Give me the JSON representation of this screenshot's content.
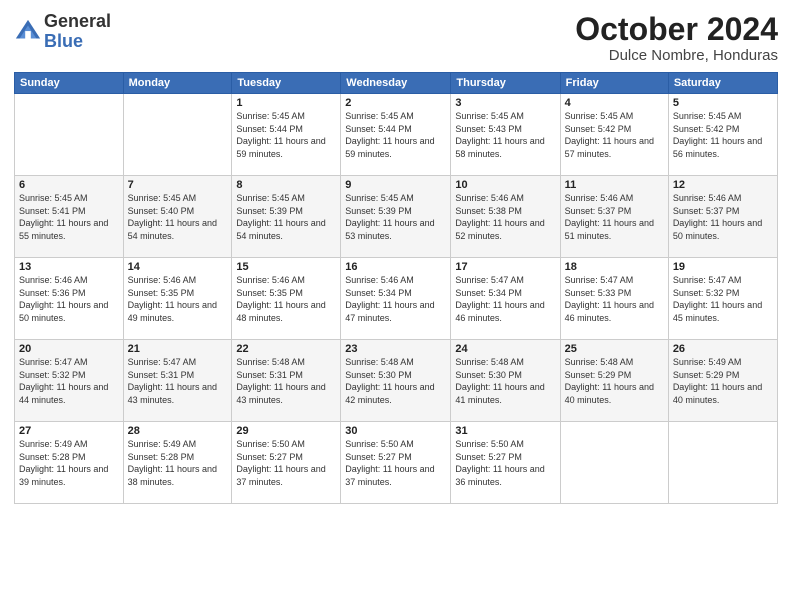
{
  "logo": {
    "general": "General",
    "blue": "Blue"
  },
  "header": {
    "month": "October 2024",
    "location": "Dulce Nombre, Honduras"
  },
  "weekdays": [
    "Sunday",
    "Monday",
    "Tuesday",
    "Wednesday",
    "Thursday",
    "Friday",
    "Saturday"
  ],
  "weeks": [
    [
      {
        "day": "",
        "sunrise": "",
        "sunset": "",
        "daylight": ""
      },
      {
        "day": "",
        "sunrise": "",
        "sunset": "",
        "daylight": ""
      },
      {
        "day": "1",
        "sunrise": "Sunrise: 5:45 AM",
        "sunset": "Sunset: 5:44 PM",
        "daylight": "Daylight: 11 hours and 59 minutes."
      },
      {
        "day": "2",
        "sunrise": "Sunrise: 5:45 AM",
        "sunset": "Sunset: 5:44 PM",
        "daylight": "Daylight: 11 hours and 59 minutes."
      },
      {
        "day": "3",
        "sunrise": "Sunrise: 5:45 AM",
        "sunset": "Sunset: 5:43 PM",
        "daylight": "Daylight: 11 hours and 58 minutes."
      },
      {
        "day": "4",
        "sunrise": "Sunrise: 5:45 AM",
        "sunset": "Sunset: 5:42 PM",
        "daylight": "Daylight: 11 hours and 57 minutes."
      },
      {
        "day": "5",
        "sunrise": "Sunrise: 5:45 AM",
        "sunset": "Sunset: 5:42 PM",
        "daylight": "Daylight: 11 hours and 56 minutes."
      }
    ],
    [
      {
        "day": "6",
        "sunrise": "Sunrise: 5:45 AM",
        "sunset": "Sunset: 5:41 PM",
        "daylight": "Daylight: 11 hours and 55 minutes."
      },
      {
        "day": "7",
        "sunrise": "Sunrise: 5:45 AM",
        "sunset": "Sunset: 5:40 PM",
        "daylight": "Daylight: 11 hours and 54 minutes."
      },
      {
        "day": "8",
        "sunrise": "Sunrise: 5:45 AM",
        "sunset": "Sunset: 5:39 PM",
        "daylight": "Daylight: 11 hours and 54 minutes."
      },
      {
        "day": "9",
        "sunrise": "Sunrise: 5:45 AM",
        "sunset": "Sunset: 5:39 PM",
        "daylight": "Daylight: 11 hours and 53 minutes."
      },
      {
        "day": "10",
        "sunrise": "Sunrise: 5:46 AM",
        "sunset": "Sunset: 5:38 PM",
        "daylight": "Daylight: 11 hours and 52 minutes."
      },
      {
        "day": "11",
        "sunrise": "Sunrise: 5:46 AM",
        "sunset": "Sunset: 5:37 PM",
        "daylight": "Daylight: 11 hours and 51 minutes."
      },
      {
        "day": "12",
        "sunrise": "Sunrise: 5:46 AM",
        "sunset": "Sunset: 5:37 PM",
        "daylight": "Daylight: 11 hours and 50 minutes."
      }
    ],
    [
      {
        "day": "13",
        "sunrise": "Sunrise: 5:46 AM",
        "sunset": "Sunset: 5:36 PM",
        "daylight": "Daylight: 11 hours and 50 minutes."
      },
      {
        "day": "14",
        "sunrise": "Sunrise: 5:46 AM",
        "sunset": "Sunset: 5:35 PM",
        "daylight": "Daylight: 11 hours and 49 minutes."
      },
      {
        "day": "15",
        "sunrise": "Sunrise: 5:46 AM",
        "sunset": "Sunset: 5:35 PM",
        "daylight": "Daylight: 11 hours and 48 minutes."
      },
      {
        "day": "16",
        "sunrise": "Sunrise: 5:46 AM",
        "sunset": "Sunset: 5:34 PM",
        "daylight": "Daylight: 11 hours and 47 minutes."
      },
      {
        "day": "17",
        "sunrise": "Sunrise: 5:47 AM",
        "sunset": "Sunset: 5:34 PM",
        "daylight": "Daylight: 11 hours and 46 minutes."
      },
      {
        "day": "18",
        "sunrise": "Sunrise: 5:47 AM",
        "sunset": "Sunset: 5:33 PM",
        "daylight": "Daylight: 11 hours and 46 minutes."
      },
      {
        "day": "19",
        "sunrise": "Sunrise: 5:47 AM",
        "sunset": "Sunset: 5:32 PM",
        "daylight": "Daylight: 11 hours and 45 minutes."
      }
    ],
    [
      {
        "day": "20",
        "sunrise": "Sunrise: 5:47 AM",
        "sunset": "Sunset: 5:32 PM",
        "daylight": "Daylight: 11 hours and 44 minutes."
      },
      {
        "day": "21",
        "sunrise": "Sunrise: 5:47 AM",
        "sunset": "Sunset: 5:31 PM",
        "daylight": "Daylight: 11 hours and 43 minutes."
      },
      {
        "day": "22",
        "sunrise": "Sunrise: 5:48 AM",
        "sunset": "Sunset: 5:31 PM",
        "daylight": "Daylight: 11 hours and 43 minutes."
      },
      {
        "day": "23",
        "sunrise": "Sunrise: 5:48 AM",
        "sunset": "Sunset: 5:30 PM",
        "daylight": "Daylight: 11 hours and 42 minutes."
      },
      {
        "day": "24",
        "sunrise": "Sunrise: 5:48 AM",
        "sunset": "Sunset: 5:30 PM",
        "daylight": "Daylight: 11 hours and 41 minutes."
      },
      {
        "day": "25",
        "sunrise": "Sunrise: 5:48 AM",
        "sunset": "Sunset: 5:29 PM",
        "daylight": "Daylight: 11 hours and 40 minutes."
      },
      {
        "day": "26",
        "sunrise": "Sunrise: 5:49 AM",
        "sunset": "Sunset: 5:29 PM",
        "daylight": "Daylight: 11 hours and 40 minutes."
      }
    ],
    [
      {
        "day": "27",
        "sunrise": "Sunrise: 5:49 AM",
        "sunset": "Sunset: 5:28 PM",
        "daylight": "Daylight: 11 hours and 39 minutes."
      },
      {
        "day": "28",
        "sunrise": "Sunrise: 5:49 AM",
        "sunset": "Sunset: 5:28 PM",
        "daylight": "Daylight: 11 hours and 38 minutes."
      },
      {
        "day": "29",
        "sunrise": "Sunrise: 5:50 AM",
        "sunset": "Sunset: 5:27 PM",
        "daylight": "Daylight: 11 hours and 37 minutes."
      },
      {
        "day": "30",
        "sunrise": "Sunrise: 5:50 AM",
        "sunset": "Sunset: 5:27 PM",
        "daylight": "Daylight: 11 hours and 37 minutes."
      },
      {
        "day": "31",
        "sunrise": "Sunrise: 5:50 AM",
        "sunset": "Sunset: 5:27 PM",
        "daylight": "Daylight: 11 hours and 36 minutes."
      },
      {
        "day": "",
        "sunrise": "",
        "sunset": "",
        "daylight": ""
      },
      {
        "day": "",
        "sunrise": "",
        "sunset": "",
        "daylight": ""
      }
    ]
  ]
}
